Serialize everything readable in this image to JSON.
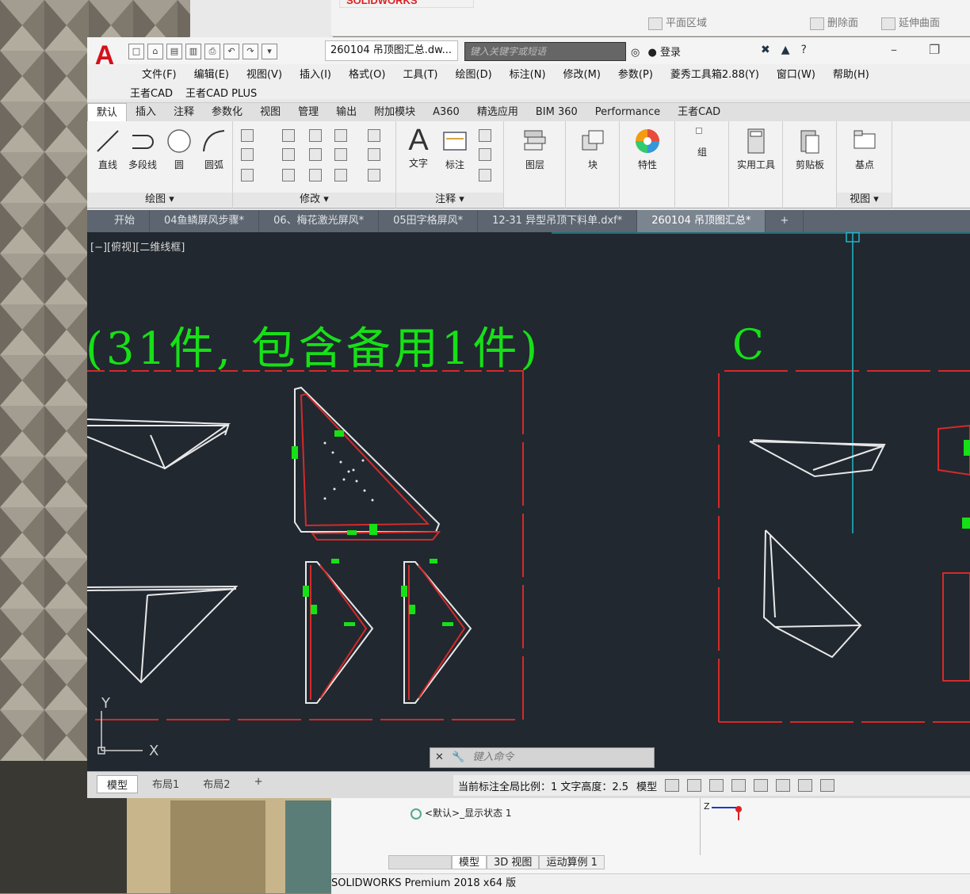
{
  "solidworks": {
    "logo_text": "SOLIDWORKS",
    "commands": [
      "平面区域",
      "删除面",
      "延伸曲面"
    ],
    "display_state": "<默认>_显示状态 1",
    "tabs": [
      "模型",
      "3D 视图",
      "运动算例 1"
    ],
    "status": "SOLIDWORKS Premium 2018 x64 版"
  },
  "autocad": {
    "document_title": "260104 吊顶图汇总.dw...",
    "search_placeholder": "键入关键字或短语",
    "login_label": "登录",
    "menu_row1": [
      "文件(F)",
      "编辑(E)",
      "视图(V)",
      "插入(I)",
      "格式(O)",
      "工具(T)",
      "绘图(D)",
      "标注(N)",
      "修改(M)",
      "参数(P)",
      "菱秀工具箱2.88(Y)",
      "窗口(W)",
      "帮助(H)"
    ],
    "menu_row2": [
      "王者CAD",
      "王者CAD PLUS"
    ],
    "ribbon_tabs": [
      "默认",
      "插入",
      "注释",
      "参数化",
      "视图",
      "管理",
      "输出",
      "附加模块",
      "A360",
      "精选应用",
      "BIM 360",
      "Performance",
      "王者CAD"
    ],
    "draw_tools": [
      "直线",
      "多段线",
      "圆",
      "圆弧"
    ],
    "panel_labels": {
      "draw": "绘图 ▾",
      "modify": "修改 ▾",
      "annotate": "注释 ▾",
      "view": "视图 ▾"
    },
    "annotate_tools": [
      "文字",
      "标注"
    ],
    "big_tools": [
      "图层",
      "块",
      "特性",
      "组",
      "实用工具",
      "剪贴板",
      "基点"
    ],
    "file_tabs": [
      "开始",
      "04鱼鳞屏风步骤*",
      "06、梅花激光屏风*",
      "05田字格屏风*",
      "12-31 异型吊顶下料单.dxf*",
      "260104 吊顶图汇总*"
    ],
    "view_label": "[−][俯视][二维线框]",
    "drawing_heading": "(31件, 包含备用1件)",
    "section_label": "C",
    "ucs_x": "X",
    "ucs_y": "Y",
    "command_placeholder": "键入命令",
    "layout_tabs": [
      "模型",
      "布局1",
      "布局2",
      "+"
    ],
    "status_text": "当前标注全局比例：1  文字高度：2.5",
    "status_model": "模型"
  },
  "colors": {
    "drawing_bg": "#212830",
    "green_text": "#17e017",
    "red_line": "#d42a2a",
    "white_line": "#e8e8e8",
    "cyan_line": "#1fb7c8"
  }
}
